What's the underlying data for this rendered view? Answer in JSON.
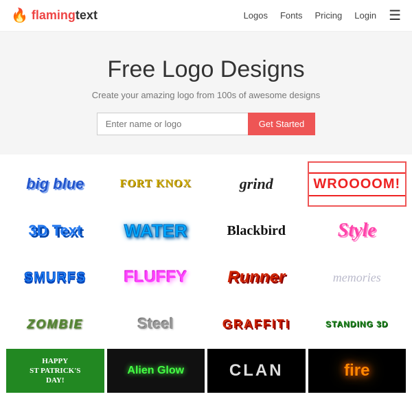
{
  "header": {
    "brand": "flamingtext",
    "brand_flaming": "flaming",
    "brand_text": "text",
    "nav": {
      "logos": "Logos",
      "fonts": "Fonts",
      "pricing": "Pricing",
      "login": "Login"
    }
  },
  "hero": {
    "title": "Free Logo Designs",
    "subtitle": "Create your amazing logo from 100s of awesome designs",
    "input_placeholder": "Enter name or logo",
    "button_label": "Get Started"
  },
  "logos": [
    {
      "id": "bigblue",
      "text": "big blue",
      "style": "bigblue"
    },
    {
      "id": "fortknox",
      "text": "FORT KNOX",
      "style": "fortknox"
    },
    {
      "id": "grind",
      "text": "grind",
      "style": "grind"
    },
    {
      "id": "wroooom",
      "text": "WROOOOM!",
      "style": "wroooom",
      "selected": true
    },
    {
      "id": "3dtext",
      "text": "3D Text",
      "style": "3dtext"
    },
    {
      "id": "water",
      "text": "WATER",
      "style": "water"
    },
    {
      "id": "blackbird",
      "text": "Blackbird",
      "style": "blackbird"
    },
    {
      "id": "style",
      "text": "Style",
      "style": "style"
    },
    {
      "id": "smurfs",
      "text": "SMURFS",
      "style": "smurfs"
    },
    {
      "id": "fluffy",
      "text": "FLUFFY",
      "style": "fluffy"
    },
    {
      "id": "runner",
      "text": "Runner",
      "style": "runner"
    },
    {
      "id": "memories",
      "text": "memories",
      "style": "memories"
    },
    {
      "id": "zombie",
      "text": "ZOMBIE",
      "style": "zombie"
    },
    {
      "id": "steel",
      "text": "Steel",
      "style": "steel"
    },
    {
      "id": "graffiti",
      "text": "GRAFFITI",
      "style": "graffiti"
    },
    {
      "id": "standing3d",
      "text": "STANDING 3D",
      "style": "standing3d"
    },
    {
      "id": "stpatrick",
      "text": "HAPPY\nST PATRICK'S\nDAY!",
      "style": "stpatrick"
    },
    {
      "id": "alienglow",
      "text": "Alien Glow",
      "style": "alienglow"
    },
    {
      "id": "clan",
      "text": "CLAN",
      "style": "clan"
    },
    {
      "id": "fire",
      "text": "fire",
      "style": "fire"
    }
  ]
}
